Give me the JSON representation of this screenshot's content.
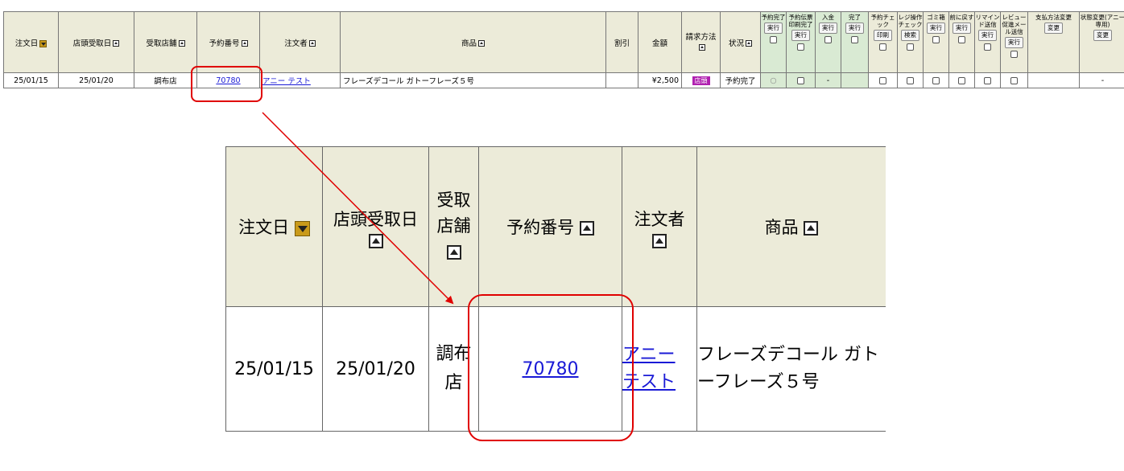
{
  "top_table": {
    "headers": {
      "order_date": "注文日",
      "pickup_date": "店頭受取日",
      "store": "受取店舗",
      "reservation_no": "予約番号",
      "customer": "注文者",
      "product": "商品",
      "discount": "割引",
      "amount": "金額",
      "billing": "請求方法",
      "status": "状況",
      "res_done": "予約完了",
      "slip_done": "予約伝票印刷完了",
      "payment": "入金",
      "complete": "完了",
      "res_check": "予約チェック",
      "register_check": "レジ操作チェック",
      "trash": "ゴミ箱",
      "revert": "前に戻す",
      "reminder": "リマインド送信",
      "review": "レビュー促進メール送信",
      "payment_change": "支払方法変更",
      "status_change": "状態変更(アニー専用)"
    },
    "buttons": {
      "run": "実行",
      "print": "印刷",
      "search": "検索",
      "change": "変更"
    },
    "row": {
      "order_date": "25/01/15",
      "pickup_date": "25/01/20",
      "store": "調布店",
      "reservation_no": "70780",
      "customer": "アニー テスト",
      "product": "フレーズデコール ガトーフレーズ５号",
      "discount": "",
      "amount": "¥2,500",
      "billing_badge": "店頭",
      "status": "予約完了",
      "res_done_mark": "○",
      "payment_mark": "-",
      "status_change": "-"
    }
  },
  "zoom_table": {
    "headers": {
      "order_date": "注文日",
      "pickup_date": "店頭受取日",
      "store": "受取店舗",
      "reservation_no": "予約番号",
      "customer": "注文者",
      "product": "商品"
    },
    "row": {
      "order_date": "25/01/15",
      "pickup_date": "25/01/20",
      "store": "調布店",
      "reservation_no": "70780",
      "customer": "アニー テスト",
      "product": "フレーズデコール ガトーフレーズ５号"
    }
  },
  "colors": {
    "header_bg": "#ecebd9",
    "green_bg": "#d9ead3",
    "link": "#1a1ad6",
    "highlight": "#e00000",
    "badge": "#b020b0"
  }
}
